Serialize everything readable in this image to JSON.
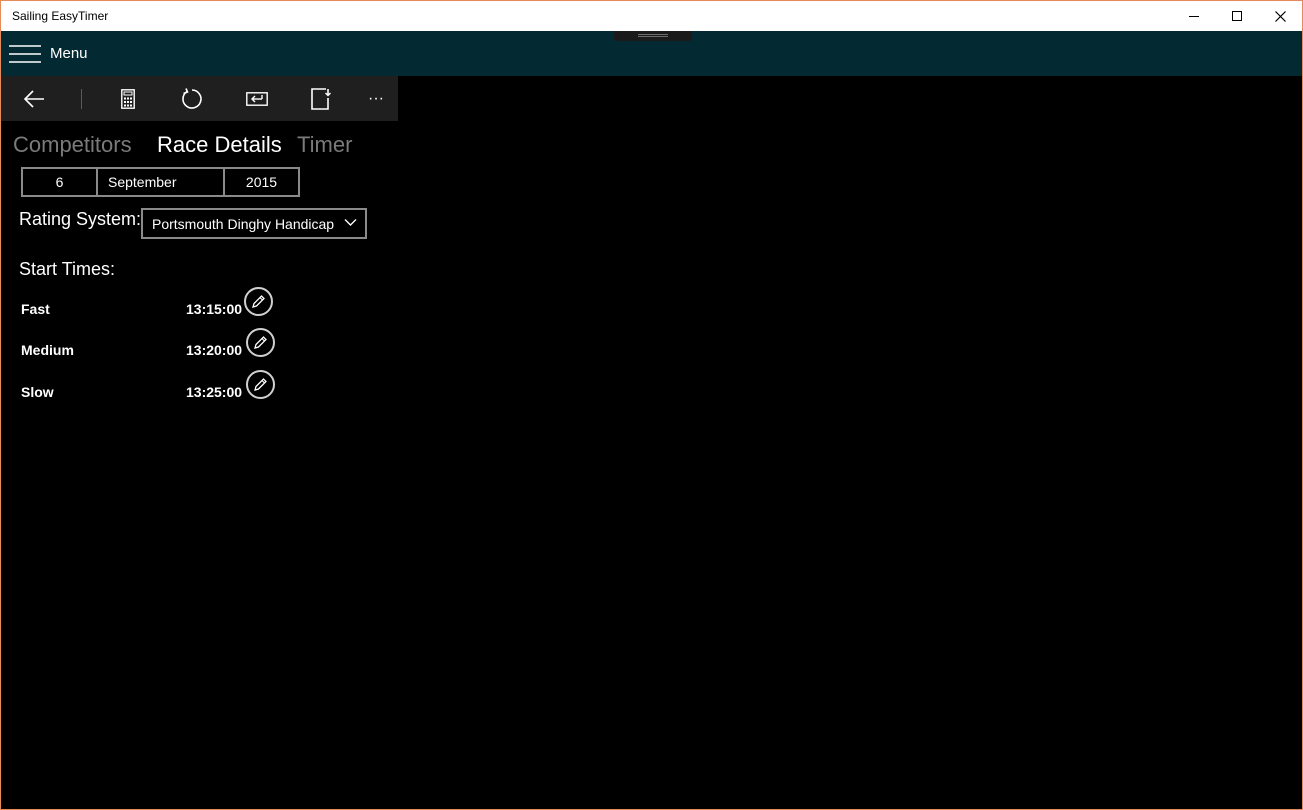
{
  "window": {
    "title": "Sailing EasyTimer",
    "controls": [
      "minimize-icon",
      "maximize-icon",
      "close-icon"
    ]
  },
  "menubar": {
    "menu_label": "Menu",
    "menu_icon": "hamburger-icon"
  },
  "commandbar": {
    "buttons": [
      "back-arrow-icon",
      "calculator-icon",
      "refresh-icon",
      "keyboard-icon",
      "export-icon",
      "more-icon"
    ],
    "more_label": "···"
  },
  "pivot": {
    "tabs": [
      "Competitors",
      "Race Details",
      "Timer"
    ],
    "selected": "Race Details"
  },
  "date": {
    "day": "6",
    "month": "September",
    "year": "2015"
  },
  "rating": {
    "label": "Rating System:",
    "value": "Portsmouth Dinghy Handicap"
  },
  "start_times": {
    "label": "Start Times:",
    "rows": [
      {
        "name": "Fast",
        "time": "13:15:00"
      },
      {
        "name": "Medium",
        "time": "13:20:00"
      },
      {
        "name": "Slow",
        "time": "13:25:00"
      }
    ]
  },
  "colors": {
    "menubar_bg": "#032a33",
    "commandbar_bg": "#1f1f1f",
    "window_border": "#e8895a",
    "inactive_tab": "#7a7a7a"
  }
}
